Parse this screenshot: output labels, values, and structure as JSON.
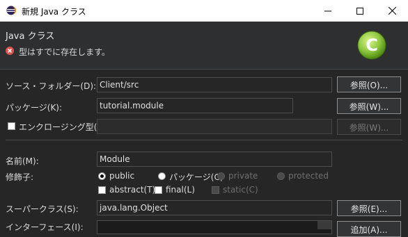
{
  "window": {
    "title": "新規 Java クラス"
  },
  "header": {
    "title": "Java クラス",
    "message": "型はすでに存在します。",
    "banner_glyph": "C"
  },
  "form": {
    "source_folder": {
      "label": "ソース・フォルダー(D):",
      "value": "Client/src",
      "button": "参照(O)..."
    },
    "package": {
      "label": "パッケージ(K):",
      "value": "tutorial.module",
      "button": "参照(W)..."
    },
    "enclosing": {
      "label": "エンクロージング型(Y):",
      "value": "",
      "button": "参照(W)...",
      "checked": false
    },
    "name": {
      "label": "名前(M):",
      "value": "Module"
    },
    "modifiers": {
      "label": "修飾子:",
      "public": "public",
      "package": "パッケージ(C)",
      "private": "private",
      "protected": "protected",
      "abstract": "abstract(T)",
      "final": "final(L)",
      "static": "static(C)",
      "selected": "public"
    },
    "superclass": {
      "label": "スーパークラス(S):",
      "value": "java.lang.Object",
      "button": "参照(E)..."
    },
    "interfaces": {
      "label": "インターフェース(I):",
      "button": "追加(A)..."
    }
  },
  "colors": {
    "accent_green": "#8dc63f",
    "error_red": "#d9534f",
    "background": "#262626"
  },
  "icons": [
    "eclipse-app-icon",
    "minimize-icon",
    "maximize-icon",
    "close-icon",
    "error-icon",
    "new-class-banner-icon"
  ]
}
